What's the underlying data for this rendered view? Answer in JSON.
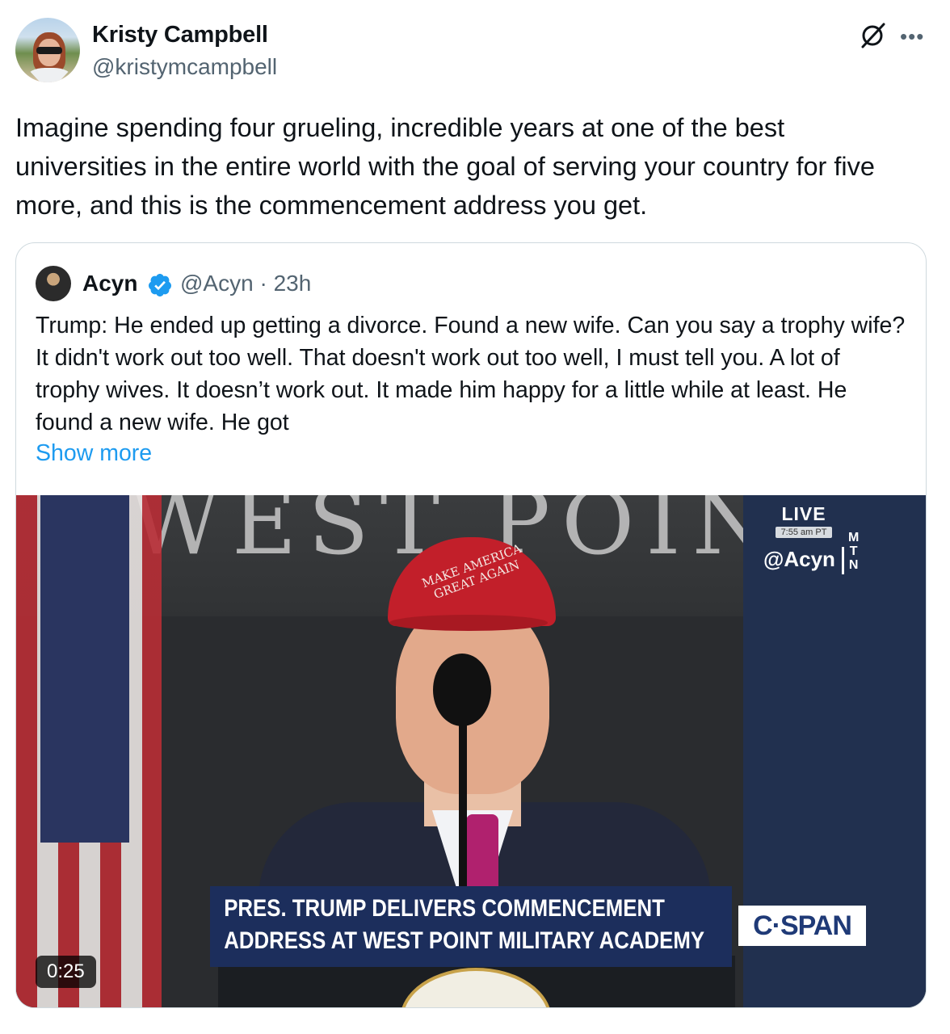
{
  "tweet": {
    "author": {
      "name": "Kristy Campbell",
      "handle": "@kristymcampbell"
    },
    "text": "Imagine spending four grueling, incredible years at one of the best universities in the entire world with the goal of serving your country for five more, and this is the commencement address you get.",
    "icons": [
      "grok-icon",
      "more-icon"
    ]
  },
  "quote": {
    "author": {
      "name": "Acyn",
      "handle": "@Acyn",
      "separator": "·",
      "time": "23h",
      "verified": true
    },
    "text": "Trump: He ended up getting a divorce. Found a new wife. Can you say a trophy wife? It didn't work out too well. That doesn't work out too well, I must tell you. A lot of trophy wives. It doesn’t work out. It made him happy for a little while at least. He found a new wife. He got",
    "show_more": "Show more",
    "video": {
      "backdrop_text": "WEST POINT",
      "cap_text": "MAKE AMERICA GREAT AGAIN",
      "live": "LIVE",
      "live_time": "7:55 am PT",
      "watermark": "@Acyn",
      "watermark_brand": "M T N",
      "chyron_line1": "PRES. TRUMP DELIVERS COMMENCEMENT",
      "chyron_line2": "ADDRESS AT WEST POINT MILITARY ACADEMY",
      "network": "C·SPAN",
      "duration": "0:25"
    }
  },
  "colors": {
    "link": "#1d9bf0",
    "secondary_text": "#536471",
    "border": "#cfd9de",
    "verified": "#1d9bf0"
  }
}
